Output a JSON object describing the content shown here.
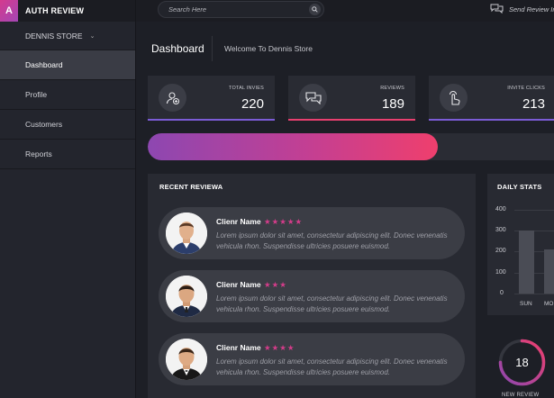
{
  "brand": {
    "logo_letter": "A",
    "title": "AUTH REVIEW"
  },
  "sidebar": {
    "store": {
      "label": "DENNIS STORE",
      "chevron_icon": "chevron-down-icon"
    },
    "items": [
      {
        "label": "Dashboard",
        "active": true
      },
      {
        "label": "Profile",
        "active": false
      },
      {
        "label": "Customers",
        "active": false
      },
      {
        "label": "Reports",
        "active": false
      }
    ]
  },
  "topbar": {
    "search": {
      "placeholder": "Search Here",
      "icon": "search-icon"
    },
    "send_review": {
      "label": "Send Review In",
      "icon": "chat-icon"
    }
  },
  "header": {
    "title": "Dashboard",
    "subtitle": "Welcome To Dennis Store"
  },
  "stats_cards": [
    {
      "label": "TOTAL INVIES",
      "value": "220",
      "icon": "add-user-icon",
      "accent": "#7b5cd6"
    },
    {
      "label": "REVIEWS",
      "value": "189",
      "icon": "chat-bubbles-icon",
      "accent": "#e83f6f"
    },
    {
      "label": "INVITE CLICKS",
      "value": "213",
      "icon": "pointer-hand-icon",
      "accent": "#7b5cd6"
    }
  ],
  "progress": {
    "fraction": 0.714,
    "colors": [
      "#8d47b1",
      "#ef3f6d"
    ]
  },
  "recent_reviews": {
    "title": "RECENT REVIEWA",
    "items": [
      {
        "name": "Clienr Name",
        "rating": 5,
        "stars": "★★★★★",
        "text": "Lorem ipsum dolor sit amet, consectetur adipiscing elit. Donec venenatis vehicula rhon. Suspendisse ultricies posuere euismod."
      },
      {
        "name": "Clienr Name",
        "rating": 3,
        "stars": "★★★",
        "text": "Lorem ipsum dolor sit amet, consectetur adipiscing elit. Donec venenatis vehicula rhon. Suspendisse ultricies posuere euismod."
      },
      {
        "name": "Clienr Name",
        "rating": 4,
        "stars": "★★★★",
        "text": "Lorem ipsum dolor sit amet, consectetur adipiscing elit. Donec venenatis vehicula rhon. Suspendisse ultricies posuere euismod."
      }
    ]
  },
  "daily_stats": {
    "title": "DAILY STATS",
    "y_ticks": [
      "400",
      "300",
      "200",
      "100",
      "0"
    ],
    "x_ticks": [
      "SUN",
      "MO"
    ],
    "values": [
      300,
      210
    ]
  },
  "new_reviews": {
    "value": "18",
    "label": "NEW REVIEW",
    "fraction": 0.75
  }
}
